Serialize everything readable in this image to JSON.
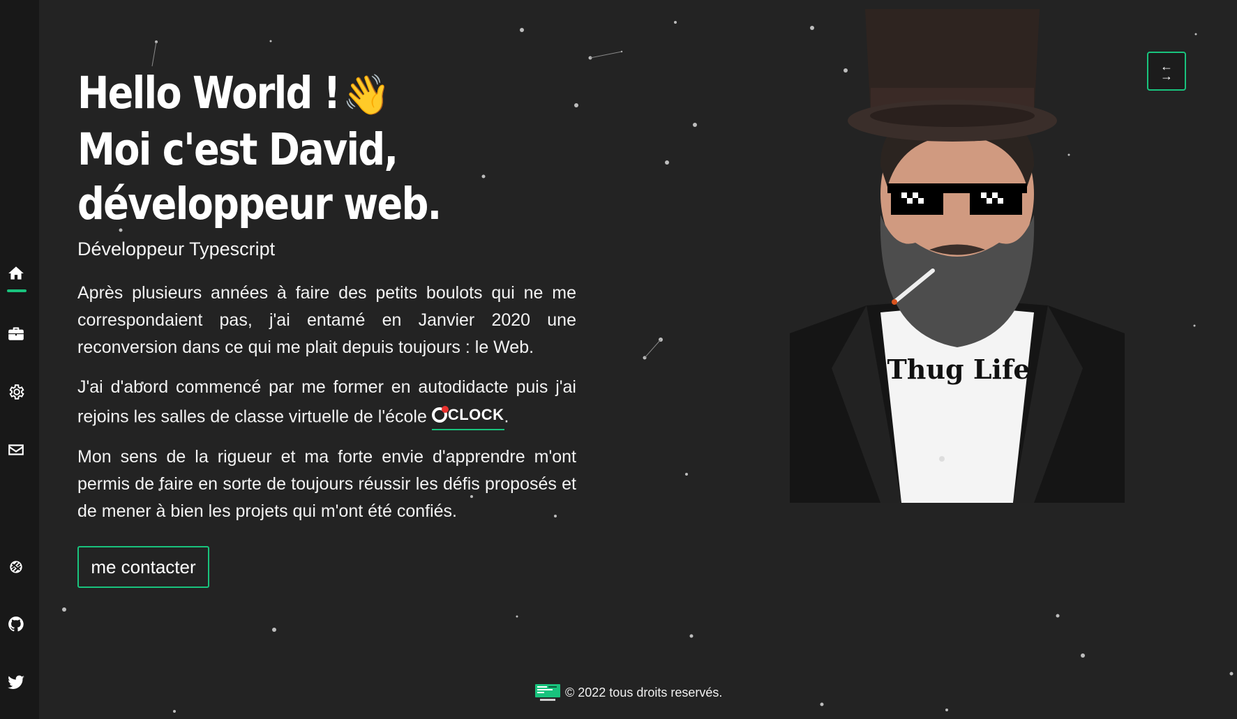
{
  "sidebar": {
    "items": [
      {
        "name": "home",
        "icon": "home-icon",
        "active": true
      },
      {
        "name": "portfolio",
        "icon": "briefcase-icon",
        "active": false
      },
      {
        "name": "skills",
        "icon": "gear-icon",
        "active": false
      },
      {
        "name": "contact",
        "icon": "mail-icon",
        "active": false
      }
    ],
    "social": [
      {
        "name": "codewars",
        "icon": "codewars-icon"
      },
      {
        "name": "github",
        "icon": "github-icon"
      },
      {
        "name": "twitter",
        "icon": "twitter-icon"
      }
    ],
    "accent_color": "#19c37d"
  },
  "hero": {
    "title_line1": "Hello World !",
    "wave_emoji": "👋",
    "title_line2": "Moi c'est David,",
    "title_line3": "développeur web.",
    "subtitle": "Développeur Typescript",
    "paragraph1": "Après plusieurs années à faire des petits boulots qui ne me correspondaient pas, j'ai entamé en Janvier 2020 une reconversion dans ce qui me plait depuis toujours : le Web.",
    "paragraph2_before": "J'ai d'abord commencé par me former en autodidacte puis j'ai rejoins les salles de classe virtuelle de l'école ",
    "school_logo_text": "CLOCK",
    "paragraph2_after": ".",
    "paragraph3": "Mon sens de la rigueur et ma forte envie d'apprendre m'ont permis de faire en sorte de toujours réussir les défis proposés et de mener à bien les projets qui m'ont été confiés.",
    "contact_button": "me contacter"
  },
  "portrait": {
    "shirt_text": "Thug Life"
  },
  "swap_button": {
    "icon": "swap-arrows-icon",
    "arrow_left": "←",
    "arrow_right": "→"
  },
  "footer": {
    "icon": "monitor-icon",
    "text": "© 2022 tous droits reservés."
  },
  "colors": {
    "background": "#232323",
    "sidebar": "#181818",
    "accent": "#19c37d"
  }
}
